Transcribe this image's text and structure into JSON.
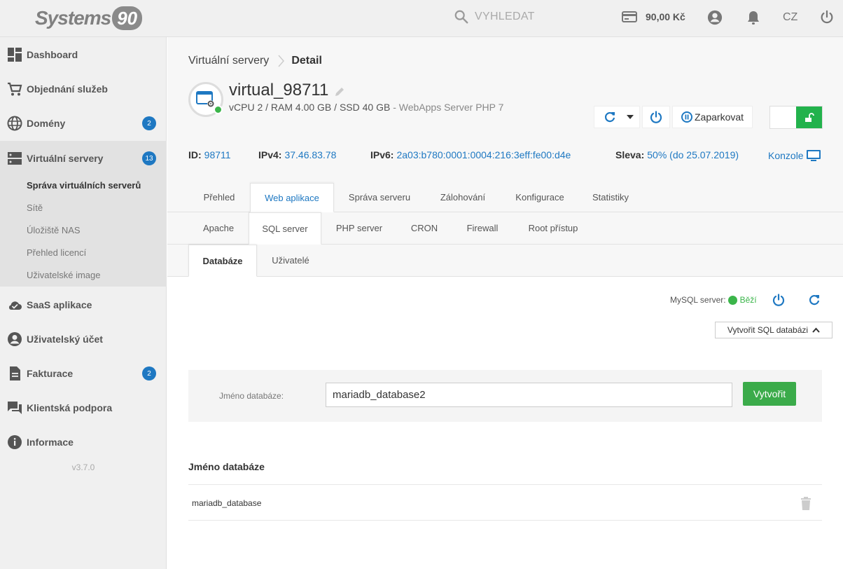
{
  "header": {
    "logo_text": "Systems",
    "logo_num": "90",
    "search_placeholder": "VYHLEDAT",
    "credit": "90,00 Kč",
    "lang": "CZ",
    "icons": [
      "search-icon",
      "card-icon",
      "user-icon",
      "bell-icon",
      "power-icon"
    ]
  },
  "sidebar": {
    "items": [
      {
        "label": "Dashboard",
        "icon": "dashboard-icon"
      },
      {
        "label": "Objednání služeb",
        "icon": "cart-icon"
      },
      {
        "label": "Domény",
        "icon": "globe-icon",
        "badge": "2"
      },
      {
        "label": "Virtuální servery",
        "icon": "server-icon",
        "badge": "13"
      },
      {
        "label": "SaaS aplikace",
        "icon": "cloud-icon"
      },
      {
        "label": "Uživatelský účet",
        "icon": "account-icon"
      },
      {
        "label": "Fakturace",
        "icon": "invoice-icon",
        "badge": "2"
      },
      {
        "label": "Klientská podpora",
        "icon": "chat-icon"
      },
      {
        "label": "Informace",
        "icon": "info-icon"
      }
    ],
    "subitems": [
      "Správa virtuálních serverů",
      "Sítě",
      "Úložiště NAS",
      "Přehled licencí",
      "Uživatelské image"
    ],
    "version": "v3.7.0"
  },
  "breadcrumb": {
    "parent": "Virtuální servery",
    "current": "Detail"
  },
  "server": {
    "name": "virtual_98711",
    "spec": "vCPU 2 / RAM 4.00 GB / SSD 40 GB",
    "spec_sep": " - ",
    "template": "WebApps Server PHP 7",
    "park_label": "Zaparkovat",
    "status_color": "#3bb54a"
  },
  "info": {
    "id_label": "ID:",
    "id": "98711",
    "ipv4_label": "IPv4:",
    "ipv4": "37.46.83.78",
    "ipv6_label": "IPv6:",
    "ipv6": "2a03:b780:0001:0004:216:3eff:fe00:d4e",
    "discount_label": "Sleva:",
    "discount": "50% (do 25.07.2019)",
    "console": "Konzole"
  },
  "tabs": {
    "main": [
      "Přehled",
      "Web aplikace",
      "Správa serveru",
      "Zálohování",
      "Konfigurace",
      "Statistiky"
    ],
    "sub": [
      "Apache",
      "SQL server",
      "PHP server",
      "CRON",
      "Firewall",
      "Root přístup"
    ],
    "sql": [
      "Databáze",
      "Uživatelé"
    ]
  },
  "mysql": {
    "label": "MySQL server:",
    "status": "Běží",
    "create_button": "Vytvořit SQL databázi"
  },
  "form": {
    "label": "Jméno databáze:",
    "value": "mariadb_database2",
    "submit": "Vytvořit"
  },
  "table": {
    "header": "Jméno databáze",
    "rows": [
      "mariadb_database"
    ]
  },
  "colors": {
    "accent": "#1e78c2",
    "success": "#3bab4a",
    "toggle_on": "#22b24c"
  }
}
